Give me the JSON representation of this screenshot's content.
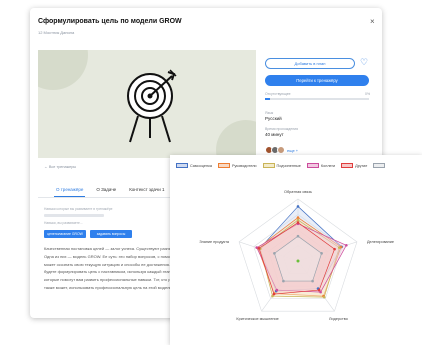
{
  "modal": {
    "title": "Сформулировать цель по модели GROW",
    "subtitle": "12 Мостник Данила",
    "close": "×"
  },
  "actions": {
    "favorite_label": "Добавить в план",
    "go_label": "Перейти к тренажёру",
    "progress_label": "Отсутствующее",
    "progress_pct": "0%",
    "progress_value": 0.05
  },
  "meta": {
    "lang_label": "Язык",
    "lang_value": "Русский",
    "time_label": "Время прохождения",
    "time_value": "40 минут",
    "avatars_more": "еще +"
  },
  "back_link": "← Все тренажеры",
  "tabs": [
    "О тренажёре",
    "О Задаче",
    "Контекст здачи 1",
    "Материа..."
  ],
  "content": {
    "hint": "Навыки которые вы развиваете в тренажёре",
    "chip_label": "Навыки, вы развиваете...",
    "pill_1": "целеполагание GROW",
    "pill_2": "задавать вопросы",
    "paragraph": "Качественная постановка целей — залог успеха. Существуют разные методики для этого. Одна из них — модель GROW. Ее суть: это набор вопросов, с помощью которых человек может осознать свою текущую ситуацию и способы ее достижения. В рамках тренажёра вы будете формулировать цель с наставником, используя каждый этап модели. Вопросы которые помогут вам развить профессиональные навыки. Тот, кто работает в этой модели, также может, использовать профессиональную цель на этой модели."
  },
  "chart_data": {
    "type": "radar",
    "axes": [
      "Обратная связь",
      "Делегирование",
      "Лидерство",
      "Критическое мышление",
      "Знание продукта"
    ],
    "series": [
      {
        "name": "Самооценка",
        "color": "#4472c4",
        "fill": "#cfdaf0",
        "values": [
          0.88,
          0.74,
          0.55,
          0.6,
          0.65
        ]
      },
      {
        "name": "Руководители",
        "color": "#ed7d31",
        "fill": "#f8d9c3",
        "values": [
          0.7,
          0.73,
          0.7,
          0.65,
          0.68
        ]
      },
      {
        "name": "Подчиненные",
        "color": "#c9b458",
        "fill": "#f3ebc9",
        "values": [
          0.66,
          0.7,
          0.72,
          0.7,
          0.64
        ]
      },
      {
        "name": "Коллеги",
        "color": "#cc4c9c",
        "fill": "#f1c9e1",
        "values": [
          0.6,
          0.82,
          0.62,
          0.58,
          0.7
        ]
      },
      {
        "name": "Другие",
        "color": "#e03c3c",
        "fill": "#f6c8c8",
        "values": [
          0.62,
          0.62,
          0.58,
          0.66,
          0.66
        ]
      },
      {
        "name": "",
        "color": "#9aa3ad",
        "fill": "#eceef0",
        "values": [
          0.4,
          0.4,
          0.4,
          0.4,
          0.4
        ]
      }
    ],
    "center_marker": "#6bbf3a",
    "grid": true,
    "legend": "top"
  },
  "colors": {
    "accent": "#2f80ed",
    "illustration_bg": "#e6e9de"
  }
}
